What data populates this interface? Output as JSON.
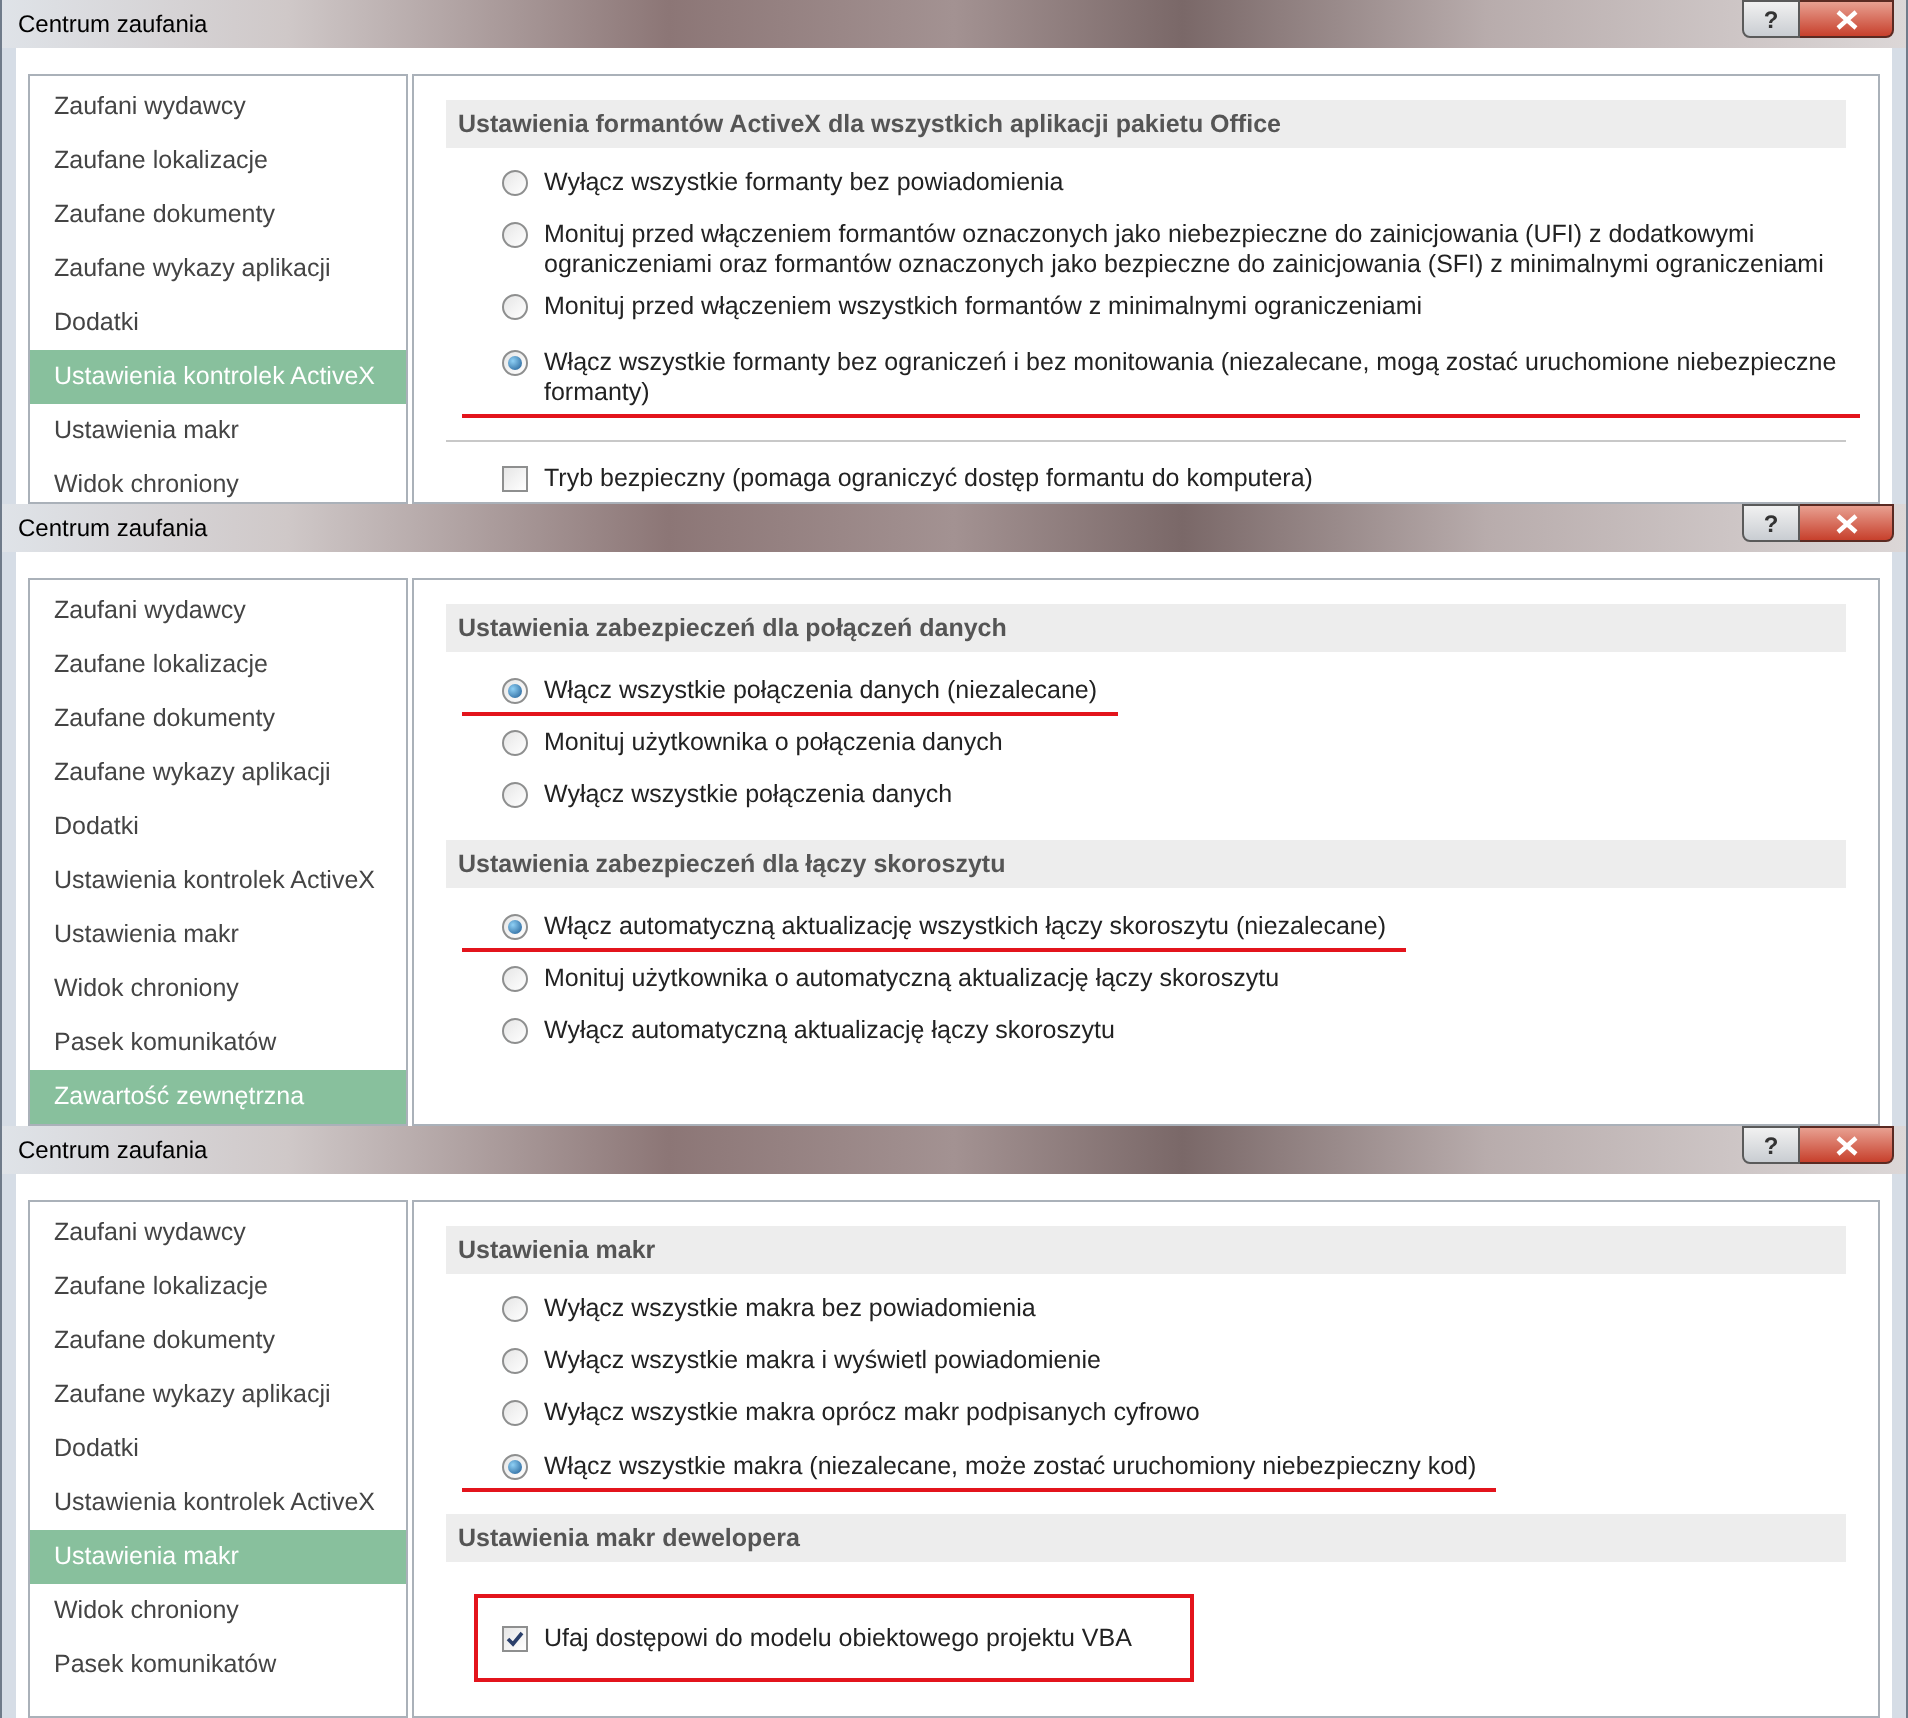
{
  "dialogs": [
    {
      "title": "Centrum zaufania",
      "help": "?",
      "nav_items": [
        {
          "label": "Zaufani wydawcy",
          "selected": false
        },
        {
          "label": "Zaufane lokalizacje",
          "selected": false
        },
        {
          "label": "Zaufane dokumenty",
          "selected": false
        },
        {
          "label": "Zaufane wykazy aplikacji",
          "selected": false
        },
        {
          "label": "Dodatki",
          "selected": false
        },
        {
          "label": "Ustawienia kontrolek ActiveX",
          "selected": true
        },
        {
          "label": "Ustawienia makr",
          "selected": false
        },
        {
          "label": "Widok chroniony",
          "selected": false
        }
      ],
      "sections": [
        {
          "heading": "Ustawienia formantów ActiveX dla wszystkich aplikacji pakietu Office",
          "items": [
            {
              "kind": "radio",
              "label": "Wyłącz wszystkie formanty bez powiadomienia",
              "selected": false,
              "marked": false
            },
            {
              "kind": "radio",
              "label": "Monituj przed włączeniem formantów oznaczonych jako niebezpieczne do zainicjowania (UFI) z dodatkowymi ograniczeniami oraz formantów oznaczonych jako bezpieczne do zainicjowania (SFI) z minimalnymi ograniczeniami",
              "selected": false,
              "marked": false
            },
            {
              "kind": "radio",
              "label": "Monituj przed włączeniem wszystkich formantów z minimalnymi ograniczeniami",
              "selected": false,
              "marked": false
            },
            {
              "kind": "radio",
              "label": "Włącz wszystkie formanty bez ograniczeń i bez monitowania (niezalecane, mogą zostać uruchomione niebezpieczne formanty)",
              "selected": true,
              "marked": true
            }
          ]
        },
        {
          "divider": true,
          "items": [
            {
              "kind": "checkbox",
              "label": "Tryb bezpieczny (pomaga ograniczyć dostęp formantu do komputera)",
              "checked": false,
              "framed": false
            }
          ]
        }
      ]
    },
    {
      "title": "Centrum zaufania",
      "help": "?",
      "nav_items": [
        {
          "label": "Zaufani wydawcy",
          "selected": false
        },
        {
          "label": "Zaufane lokalizacje",
          "selected": false
        },
        {
          "label": "Zaufane dokumenty",
          "selected": false
        },
        {
          "label": "Zaufane wykazy aplikacji",
          "selected": false
        },
        {
          "label": "Dodatki",
          "selected": false
        },
        {
          "label": "Ustawienia kontrolek ActiveX",
          "selected": false
        },
        {
          "label": "Ustawienia makr",
          "selected": false
        },
        {
          "label": "Widok chroniony",
          "selected": false
        },
        {
          "label": "Pasek komunikatów",
          "selected": false
        },
        {
          "label": "Zawartość zewnętrzna",
          "selected": true
        }
      ],
      "sections": [
        {
          "heading": "Ustawienia zabezpieczeń dla połączeń danych",
          "items": [
            {
              "kind": "radio",
              "label": "Włącz wszystkie połączenia danych (niezalecane)",
              "selected": true,
              "marked": true
            },
            {
              "kind": "radio",
              "label": "Monituj użytkownika o połączenia danych",
              "selected": false,
              "marked": false
            },
            {
              "kind": "radio",
              "label": "Wyłącz wszystkie połączenia danych",
              "selected": false,
              "marked": false
            }
          ]
        },
        {
          "heading": "Ustawienia zabezpieczeń dla łączy skoroszytu",
          "items": [
            {
              "kind": "radio",
              "label": "Włącz automatyczną aktualizację wszystkich łączy skoroszytu (niezalecane)",
              "selected": true,
              "marked": true
            },
            {
              "kind": "radio",
              "label": "Monituj użytkownika o automatyczną aktualizację łączy skoroszytu",
              "selected": false,
              "marked": false
            },
            {
              "kind": "radio",
              "label": "Wyłącz automatyczną aktualizację łączy skoroszytu",
              "selected": false,
              "marked": false
            }
          ]
        }
      ]
    },
    {
      "title": "Centrum zaufania",
      "help": "?",
      "nav_items": [
        {
          "label": "Zaufani wydawcy",
          "selected": false
        },
        {
          "label": "Zaufane lokalizacje",
          "selected": false
        },
        {
          "label": "Zaufane dokumenty",
          "selected": false
        },
        {
          "label": "Zaufane wykazy aplikacji",
          "selected": false
        },
        {
          "label": "Dodatki",
          "selected": false
        },
        {
          "label": "Ustawienia kontrolek ActiveX",
          "selected": false
        },
        {
          "label": "Ustawienia makr",
          "selected": true
        },
        {
          "label": "Widok chroniony",
          "selected": false
        },
        {
          "label": "Pasek komunikatów",
          "selected": false
        }
      ],
      "sections": [
        {
          "heading": "Ustawienia makr",
          "items": [
            {
              "kind": "radio",
              "label": "Wyłącz wszystkie makra bez powiadomienia",
              "selected": false,
              "marked": false
            },
            {
              "kind": "radio",
              "label": "Wyłącz wszystkie makra i wyświetl powiadomienie",
              "selected": false,
              "marked": false
            },
            {
              "kind": "radio",
              "label": "Wyłącz wszystkie makra oprócz makr podpisanych cyfrowo",
              "selected": false,
              "marked": false
            },
            {
              "kind": "radio",
              "label": "Włącz wszystkie makra (niezalecane, może zostać uruchomiony niebezpieczny kod)",
              "selected": true,
              "marked": true
            }
          ]
        },
        {
          "heading": "Ustawienia makr dewelopera",
          "items": [
            {
              "kind": "checkbox",
              "label": "Ufaj dostępowi do modelu obiektowego projektu VBA",
              "checked": true,
              "framed": true
            }
          ]
        }
      ]
    }
  ]
}
